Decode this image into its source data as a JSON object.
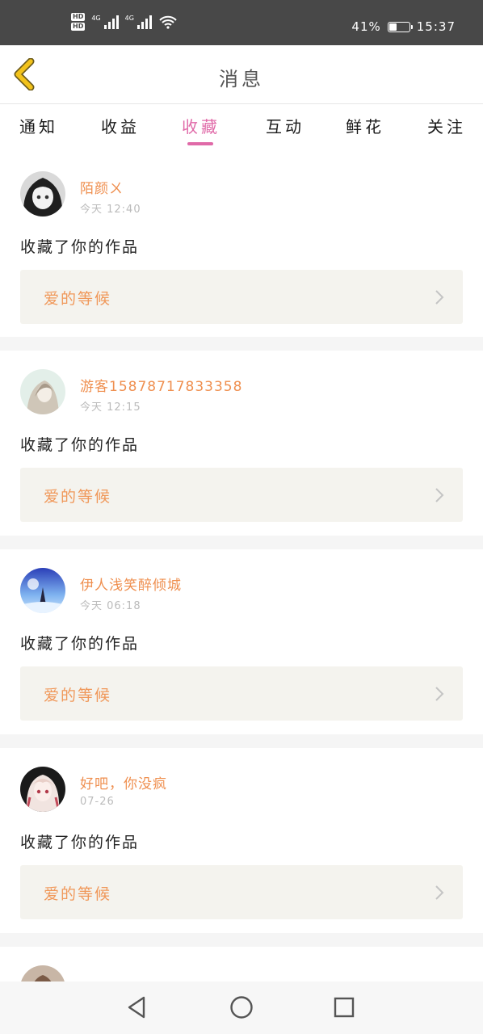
{
  "status_bar": {
    "hd1": "HD",
    "hd2": "HD",
    "net1": "4G",
    "net2": "4G",
    "battery_pct": "41%",
    "battery_level": 0.41,
    "time": "15:37"
  },
  "header": {
    "title": "消息",
    "back_icon": "chevron-left-icon"
  },
  "tabs": [
    {
      "label": "通知"
    },
    {
      "label": "收益"
    },
    {
      "label": "收藏",
      "active": true
    },
    {
      "label": "互动"
    },
    {
      "label": "鲜花"
    },
    {
      "label": "关注"
    }
  ],
  "items": [
    {
      "user": "陌颜ㄨ",
      "time": "今天 12:40",
      "action": "收藏了你的作品",
      "work": "爱的等候"
    },
    {
      "user": "游客15878717833358",
      "time": "今天 12:15",
      "action": "收藏了你的作品",
      "work": "爱的等候"
    },
    {
      "user": "伊人浅笑醉倾城",
      "time": "今天 06:18",
      "action": "收藏了你的作品",
      "work": "爱的等候"
    },
    {
      "user": "好吧，你没疯",
      "time": "07-26",
      "action": "收藏了你的作品",
      "work": "爱的等候"
    }
  ],
  "colors": {
    "accent": "#e06aa8",
    "username": "#ef8f4f",
    "work_title": "#f0985a",
    "back_icon": "#f2c21a"
  },
  "navbar": {
    "icons": [
      "back-triangle-icon",
      "home-circle-icon",
      "recents-square-icon"
    ]
  }
}
